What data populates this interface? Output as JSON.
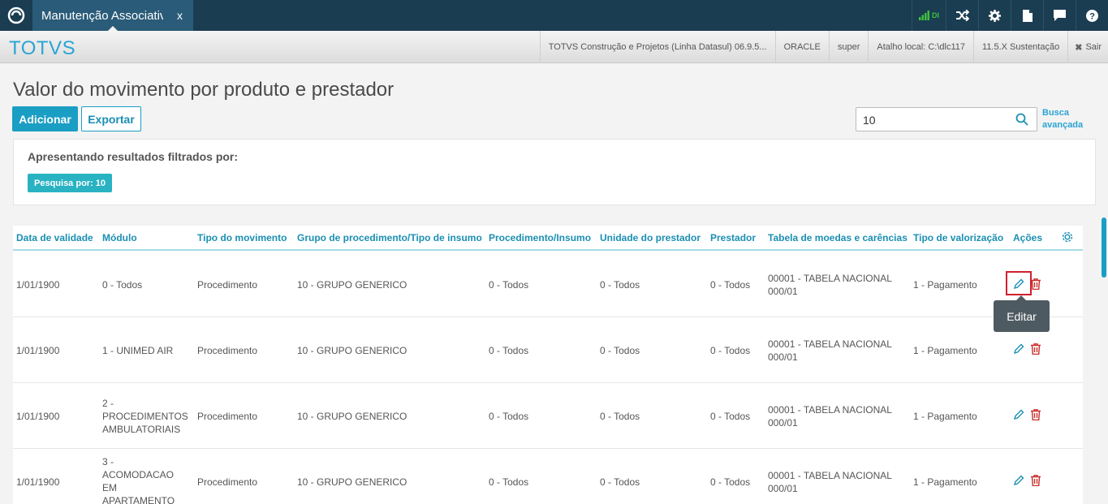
{
  "topbar": {
    "tab_label": "Manutenção Associativa",
    "tab_close": "x",
    "signal_text": "DI"
  },
  "brandbar": {
    "brand": "TOTVS",
    "items": [
      "TOTVS Construção e Projetos (Linha Datasul) 06.9.5...",
      "ORACLE",
      "super",
      "Atalho local: C:\\dlc117",
      "11.5.X Sustentação"
    ],
    "sair": "Sair"
  },
  "page": {
    "title": "Valor do movimento por produto e prestador",
    "add_label": "Adicionar",
    "export_label": "Exportar",
    "search_value": "10",
    "busca_line1": "Busca",
    "busca_line2": "avançada"
  },
  "filter": {
    "title": "Apresentando resultados filtrados por:",
    "tag": "Pesquisa por: 10"
  },
  "table": {
    "headers": [
      "Data de validade",
      "Módulo",
      "Tipo do movimento",
      "Grupo de procedimento/Tipo de insumo",
      "Procedimento/Insumo",
      "Unidade do prestador",
      "Prestador",
      "Tabela de moedas e carências",
      "Tipo de valorização",
      "Ações"
    ],
    "rows": [
      {
        "data": "1/01/1900",
        "modulo": [
          "0 - Todos"
        ],
        "tipo": "Procedimento",
        "grupo": "10 - GRUPO GENERICO",
        "proc": "0 - Todos",
        "unidade": "0 - Todos",
        "prestador": "0 - Todos",
        "tabela": [
          "00001 - TABELA NACIONAL",
          "000/01"
        ],
        "valorizacao": "1 - Pagamento"
      },
      {
        "data": "1/01/1900",
        "modulo": [
          "1 - UNIMED AIR"
        ],
        "tipo": "Procedimento",
        "grupo": "10 - GRUPO GENERICO",
        "proc": "0 - Todos",
        "unidade": "0 - Todos",
        "prestador": "0 - Todos",
        "tabela": [
          "00001 - TABELA NACIONAL",
          "000/01"
        ],
        "valorizacao": "1 - Pagamento"
      },
      {
        "data": "1/01/1900",
        "modulo": [
          "2 -",
          "PROCEDIMENTOS",
          "AMBULATORIAIS"
        ],
        "tipo": "Procedimento",
        "grupo": "10 - GRUPO GENERICO",
        "proc": "0 - Todos",
        "unidade": "0 - Todos",
        "prestador": "0 - Todos",
        "tabela": [
          "00001 - TABELA NACIONAL",
          "000/01"
        ],
        "valorizacao": "1 - Pagamento"
      },
      {
        "data": "1/01/1900",
        "modulo": [
          "3 -",
          "ACOMODACAO",
          "EM",
          "APARTAMENTO"
        ],
        "tipo": "Procedimento",
        "grupo": "10 - GRUPO GENERICO",
        "proc": "0 - Todos",
        "unidade": "0 - Todos",
        "prestador": "0 - Todos",
        "tabela": [
          "00001 - TABELA NACIONAL",
          "000/01"
        ],
        "valorizacao": "1 - Pagamento"
      }
    ],
    "tooltip": "Editar"
  },
  "colors": {
    "accent": "#1b9ec4",
    "topbar": "#1a3d52",
    "delete": "#c9302c",
    "highlight": "#d0202e"
  }
}
